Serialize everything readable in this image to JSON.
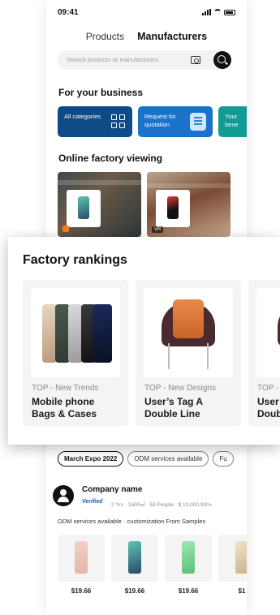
{
  "status": {
    "time": "09:41"
  },
  "tabs": [
    {
      "label": "Products"
    },
    {
      "label": "Manufacturers"
    }
  ],
  "search": {
    "placeholder": "Search products or manufacturers"
  },
  "business": {
    "title": "For your business",
    "cards": [
      {
        "label": "All categories"
      },
      {
        "label": "Request for quotation"
      },
      {
        "label": "Your bene"
      }
    ]
  },
  "factory_viewing": {
    "title": "Online factory viewing",
    "vr_label": "VR"
  },
  "rankings": {
    "title": "Factory rankings",
    "items": [
      {
        "tag": "TOP - New Trends",
        "name_line1": "Mobile phone",
        "name_line2": "Bags & Cases"
      },
      {
        "tag": "TOP - New Designs",
        "name_line1": "User’s Tag A",
        "name_line2": "Double Line"
      },
      {
        "tag": "TOP -",
        "name_line1": "User",
        "name_line2": "Doub"
      }
    ]
  },
  "chips": [
    {
      "label": "March Expo 2022"
    },
    {
      "label": "ODM services available"
    },
    {
      "label": "Fu"
    }
  ],
  "company": {
    "name": "Company name",
    "verified": "Verified",
    "meta": "2 Yrs · 1500㎡ · 53 People · $ 10,000,000+",
    "description": "ODM services available · customization From Samples",
    "products": [
      {
        "price": "$19.66"
      },
      {
        "price": "$19.66"
      },
      {
        "price": "$19.66"
      },
      {
        "price": "$1"
      }
    ]
  },
  "colors": {
    "biz_dark": "#0e4b87",
    "biz_blue": "#1a72c9",
    "biz_teal": "#129a95",
    "verified": "#1a5fb4"
  }
}
